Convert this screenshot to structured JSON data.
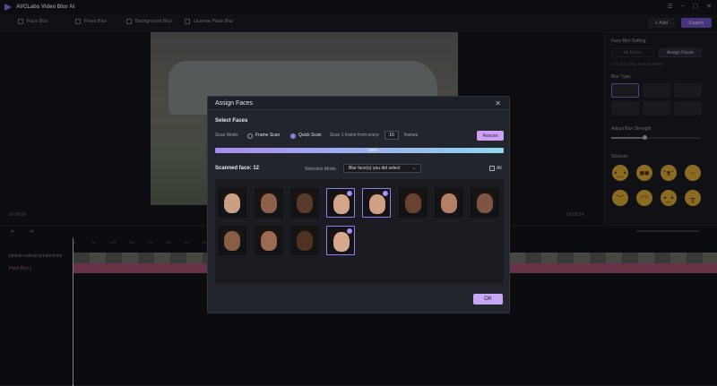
{
  "app": {
    "title": "AVCLabs Video Blur AI"
  },
  "tabs": [
    {
      "label": "Face Blur"
    },
    {
      "label": "Fixed Blur"
    },
    {
      "label": "Background Blur"
    },
    {
      "label": "License Plate Blur"
    }
  ],
  "toolbar": {
    "add_label": "+ Add",
    "export_label": "Export"
  },
  "viewer": {
    "time_left": "00:00:00",
    "time_right": "00:00:14"
  },
  "right_panel": {
    "setting_title": "Face Blur Setting:",
    "all_faces": "All Faces",
    "assign_faces": "Assign Faces",
    "note": "4 face(s) have been selected",
    "blur_type_title": "Blur Type:",
    "strength_title": "Adjust Blur Strength",
    "strength_value": 0.37,
    "stickers_title": "Stickers:"
  },
  "timeline": {
    "track_video": "pexels-rodnae-productions",
    "track_blur": "Face Blur 1",
    "ruler": [
      "0",
      "5s",
      "10s",
      "15s",
      "20s",
      "25s",
      "30s",
      "35s",
      "40s",
      "45s",
      "50s",
      "55s",
      "1m",
      "2m",
      "3m",
      "4m",
      "5m",
      "6m",
      "7m",
      "8m"
    ]
  },
  "modal": {
    "title": "Assign Faces",
    "section_title": "Select Faces",
    "scan_mode_label": "Scan Mode:",
    "frame_scan": "Frame Scan",
    "quick_scan": "Quick Scan",
    "scan_every_label": "Scan 1 frame from every",
    "frames_value": "10",
    "frames_unit": "frames",
    "rescan_label": "Rescan",
    "progress_text": "100%",
    "progress_value": 1.0,
    "scanned_label": "Scanned face: 12",
    "selection_mode_label": "Selection Mode:",
    "selection_mode_value": "Blur face(s) you did select",
    "all_label": "All",
    "ok_label": "OK",
    "faces": [
      {
        "selected": false,
        "skin": "#caa085"
      },
      {
        "selected": false,
        "skin": "#8c6048"
      },
      {
        "selected": false,
        "skin": "#5a3a28"
      },
      {
        "selected": true,
        "skin": "#d3a58a"
      },
      {
        "selected": true,
        "skin": "#cfa084"
      },
      {
        "selected": false,
        "skin": "#6a4330"
      },
      {
        "selected": false,
        "skin": "#b38065"
      },
      {
        "selected": false,
        "skin": "#7d5540"
      },
      {
        "selected": false,
        "skin": "#8a5e46"
      },
      {
        "selected": false,
        "skin": "#9c6c52"
      },
      {
        "selected": false,
        "skin": "#4f3222"
      },
      {
        "selected": true,
        "skin": "#d7aa8f"
      }
    ]
  }
}
